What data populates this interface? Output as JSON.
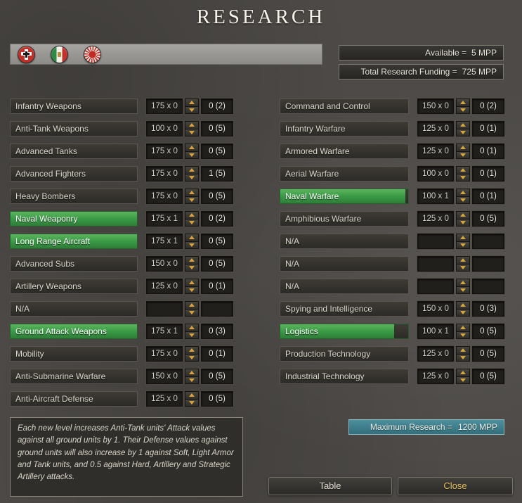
{
  "title": "RESEARCH",
  "header": {
    "flags": [
      "germany-roundel-flag",
      "italy-flag",
      "japan-rising-sun-flag"
    ],
    "available_label": "Available =",
    "available_value": "5 MPP",
    "funding_label": "Total Research Funding =",
    "funding_value": "725 MPP"
  },
  "accent_colors": {
    "active_green": "#3b9a46",
    "spinner_arrow_gold": "#d9a33a",
    "max_bar_teal": "#3f7d8a",
    "close_text_gold": "#e7c55c"
  },
  "columns": {
    "left": [
      {
        "label": "Infantry Weapons",
        "cost": "175 x 0",
        "count": "0 (2)",
        "active": false,
        "fill": 0
      },
      {
        "label": "Anti-Tank Weapons",
        "cost": "100 x 0",
        "count": "0 (5)",
        "active": false,
        "fill": 0
      },
      {
        "label": "Advanced Tanks",
        "cost": "175 x 0",
        "count": "0 (5)",
        "active": false,
        "fill": 0
      },
      {
        "label": "Advanced Fighters",
        "cost": "175 x 0",
        "count": "1 (5)",
        "active": false,
        "fill": 0
      },
      {
        "label": "Heavy Bombers",
        "cost": "175 x 0",
        "count": "0 (5)",
        "active": false,
        "fill": 0
      },
      {
        "label": "Naval Weaponry",
        "cost": "175 x 1",
        "count": "0 (2)",
        "active": true,
        "fill": 100
      },
      {
        "label": "Long Range Aircraft",
        "cost": "175 x 1",
        "count": "0 (5)",
        "active": true,
        "fill": 100
      },
      {
        "label": "Advanced Subs",
        "cost": "150 x 0",
        "count": "0 (5)",
        "active": false,
        "fill": 0
      },
      {
        "label": "Artillery Weapons",
        "cost": "125 x 0",
        "count": "0 (1)",
        "active": false,
        "fill": 0
      },
      {
        "label": "N/A",
        "cost": "",
        "count": "",
        "active": false,
        "fill": 0
      },
      {
        "label": "Ground Attack Weapons",
        "cost": "175 x 1",
        "count": "0 (3)",
        "active": true,
        "fill": 100
      },
      {
        "label": "Mobility",
        "cost": "175 x 0",
        "count": "0 (1)",
        "active": false,
        "fill": 0
      },
      {
        "label": "Anti-Submarine Warfare",
        "cost": "150 x 0",
        "count": "0 (5)",
        "active": false,
        "fill": 0
      },
      {
        "label": "Anti-Aircraft Defense",
        "cost": "125 x 0",
        "count": "0 (5)",
        "active": false,
        "fill": 0
      }
    ],
    "right": [
      {
        "label": "Command and Control",
        "cost": "150 x 0",
        "count": "0 (2)",
        "active": false,
        "fill": 0
      },
      {
        "label": "Infantry Warfare",
        "cost": "125 x 0",
        "count": "0 (1)",
        "active": false,
        "fill": 0
      },
      {
        "label": "Armored Warfare",
        "cost": "125 x 0",
        "count": "0 (1)",
        "active": false,
        "fill": 0
      },
      {
        "label": "Aerial Warfare",
        "cost": "100 x 0",
        "count": "0 (1)",
        "active": false,
        "fill": 0
      },
      {
        "label": "Naval Warfare",
        "cost": "100 x 1",
        "count": "0 (1)",
        "active": true,
        "fill": 98
      },
      {
        "label": "Amphibious Warfare",
        "cost": "125 x 0",
        "count": "0 (5)",
        "active": false,
        "fill": 0
      },
      {
        "label": "N/A",
        "cost": "",
        "count": "",
        "active": false,
        "fill": 0
      },
      {
        "label": "N/A",
        "cost": "",
        "count": "",
        "active": false,
        "fill": 0
      },
      {
        "label": "N/A",
        "cost": "",
        "count": "",
        "active": false,
        "fill": 0
      },
      {
        "label": "Spying and Intelligence",
        "cost": "150 x 0",
        "count": "0 (3)",
        "active": false,
        "fill": 0
      },
      {
        "label": "Logistics",
        "cost": "100 x 1",
        "count": "0 (5)",
        "active": true,
        "fill": 89
      },
      {
        "label": "Production Technology",
        "cost": "125 x 0",
        "count": "0 (5)",
        "active": false,
        "fill": 0
      },
      {
        "label": "Industrial Technology",
        "cost": "125 x 0",
        "count": "0 (5)",
        "active": false,
        "fill": 0
      }
    ]
  },
  "description": "Each new level increases Anti-Tank units' Attack values against all ground units by 1. Their Defense values against ground units will also increase by 1 against Soft, Light Armor and Tank units, and 0.5 against Hard, Artillery and Strategic Artillery attacks.",
  "footer": {
    "maximum_label": "Maximum Research =",
    "maximum_value": "1200 MPP",
    "table_button": "Table",
    "close_button": "Close"
  }
}
